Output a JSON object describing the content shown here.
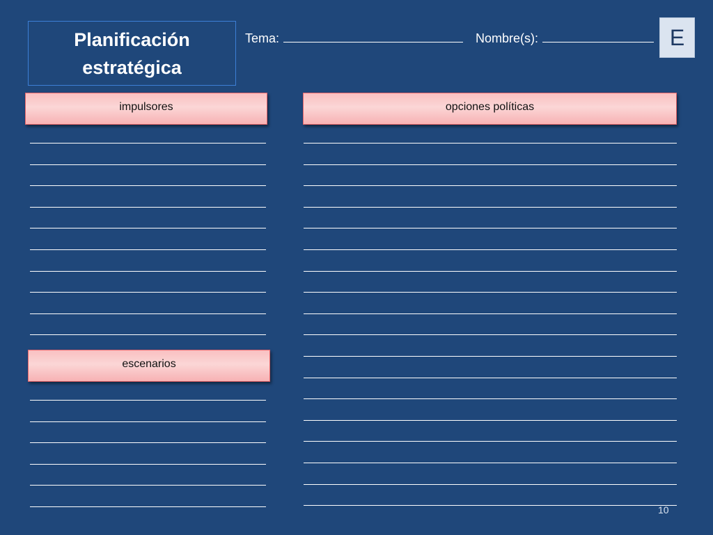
{
  "title": "Planificación estratégica",
  "header": {
    "tema_label": "Tema:",
    "nombre_label": "Nombre(s):"
  },
  "badge_letter": "E",
  "sections": {
    "impulsores": {
      "label": "impulsores",
      "blank_line_count": 10
    },
    "escenarios": {
      "label": "escenarios",
      "blank_line_count": 6
    },
    "opciones": {
      "label": "opciones políticas",
      "blank_line_count": 18
    }
  },
  "page_number": "10",
  "colors": {
    "background": "#1f477a",
    "title_border": "#3d7fd6",
    "section_header_fill": "#fbd6d6",
    "section_header_border": "#e5666a",
    "line": "#ffffff",
    "badge_fill": "#dbe4f0"
  }
}
